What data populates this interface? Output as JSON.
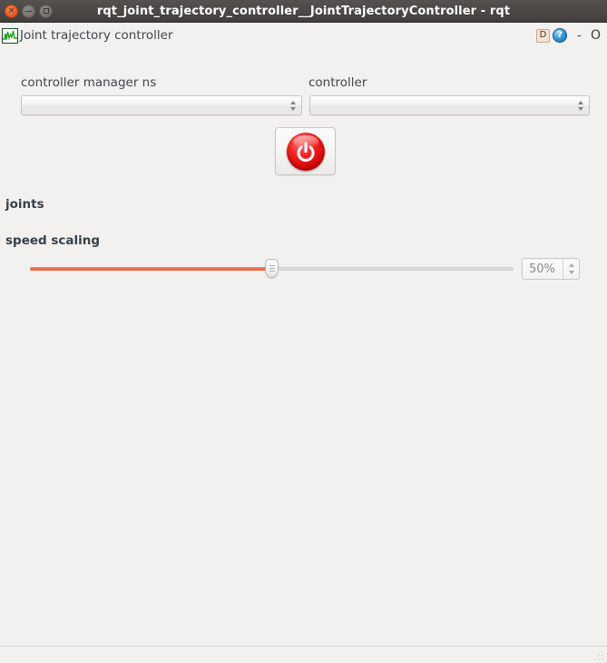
{
  "window": {
    "title": "rqt_joint_trajectory_controller__JointTrajectoryController - rqt",
    "buttons": {
      "close": "×",
      "minimize": "",
      "maximize": ""
    }
  },
  "plugin_header": {
    "icon": "rqt-plot-icon",
    "title": "Joint trajectory controller",
    "controls": {
      "dock_label": "D",
      "help_label": "?",
      "hide_label": "-",
      "close_label": "O"
    }
  },
  "form": {
    "controller_manager_ns": {
      "label": "controller manager ns",
      "value": "",
      "placeholder": ""
    },
    "controller": {
      "label": "controller",
      "value": "",
      "placeholder": ""
    },
    "power_button": {
      "icon": "power-icon",
      "state": "off"
    },
    "joints": {
      "label": "joints"
    },
    "speed_scaling": {
      "label": "speed scaling",
      "slider_value": 50,
      "slider_min": 0,
      "slider_max": 100,
      "spinbox_value": "50%"
    }
  },
  "colors": {
    "titlebar_bg": "#4a4745",
    "window_bg": "#f2f1f0",
    "label_text": "#3c4650",
    "accent_orange": "#e9633a",
    "power_red": "#e01010",
    "close_button": "#e8622a",
    "help_blue": "#3f9bd8"
  },
  "statusbar": {
    "text": "",
    "size_grip": "resize-grip-icon"
  }
}
